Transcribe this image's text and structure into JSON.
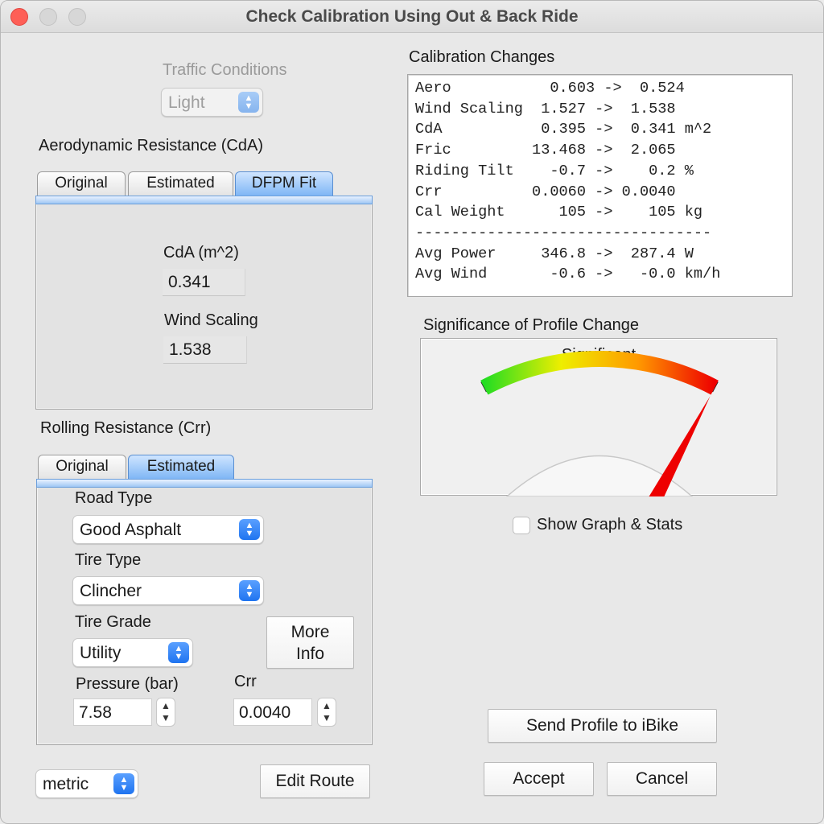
{
  "window": {
    "title": "Check Calibration Using Out & Back Ride"
  },
  "traffic": {
    "label": "Traffic Conditions",
    "value": "Light"
  },
  "aero": {
    "heading": "Aerodynamic Resistance (CdA)",
    "tabs": [
      "Original",
      "Estimated",
      "DFPM Fit"
    ],
    "selected_tab": "DFPM Fit",
    "cda_label": "CdA (m^2)",
    "cda_value": "0.341",
    "wind_label": "Wind Scaling",
    "wind_value": "1.538"
  },
  "rolling": {
    "heading": "Rolling Resistance (Crr)",
    "tabs": [
      "Original",
      "Estimated"
    ],
    "selected_tab": "Estimated",
    "road_label": "Road Type",
    "road_value": "Good Asphalt",
    "tire_label": "Tire Type",
    "tire_value": "Clincher",
    "grade_label": "Tire Grade",
    "grade_value": "Utility",
    "more_info_line1": "More",
    "more_info_line2": "Info",
    "pressure_label": "Pressure (bar)",
    "pressure_value": "7.58",
    "crr_label": "Crr",
    "crr_value": "0.0040"
  },
  "bottom_left": {
    "units_value": "metric",
    "edit_route": "Edit Route"
  },
  "calibration": {
    "heading": "Calibration Changes",
    "lines": [
      "Aero           0.603 ->  0.524",
      "Wind Scaling  1.527 ->  1.538",
      "CdA           0.395 ->  0.341 m^2",
      "Fric         13.468 ->  2.065",
      "Riding Tilt    -0.7 ->    0.2 %",
      "Crr          0.0060 -> 0.0040",
      "Cal Weight      105 ->    105 kg",
      "---------------------------------",
      "Avg Power     346.8 ->  287.4 W",
      "Avg Wind       -0.6 ->   -0.0 km/h"
    ]
  },
  "significance": {
    "heading": "Significance of Profile Change",
    "gauge_label": "Significant",
    "level": 1.0,
    "colors": [
      "#22dd22",
      "#eeee00",
      "#ff9900",
      "#ee0000"
    ]
  },
  "show_graph": {
    "label": "Show Graph & Stats",
    "checked": false
  },
  "actions": {
    "send_profile": "Send Profile to iBike",
    "accept": "Accept",
    "cancel": "Cancel"
  }
}
